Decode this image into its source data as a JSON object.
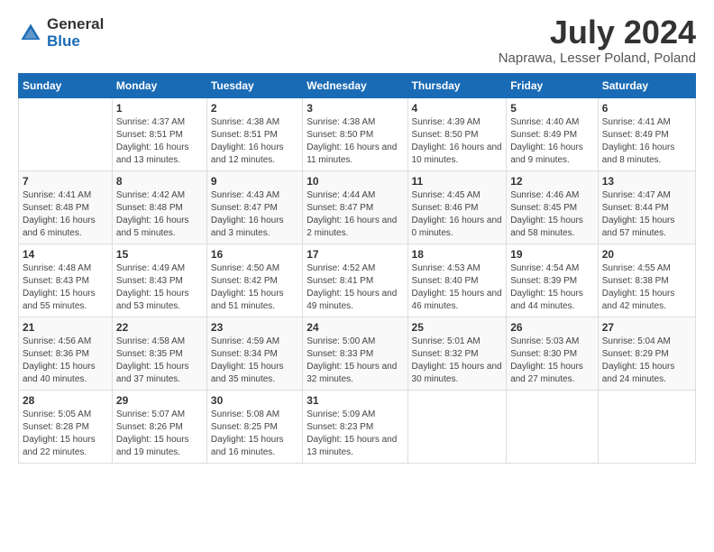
{
  "logo": {
    "general": "General",
    "blue": "Blue"
  },
  "title": "July 2024",
  "subtitle": "Naprawa, Lesser Poland, Poland",
  "columns": [
    "Sunday",
    "Monday",
    "Tuesday",
    "Wednesday",
    "Thursday",
    "Friday",
    "Saturday"
  ],
  "weeks": [
    [
      {
        "day": "",
        "sunrise": "",
        "sunset": "",
        "daylight": ""
      },
      {
        "day": "1",
        "sunrise": "Sunrise: 4:37 AM",
        "sunset": "Sunset: 8:51 PM",
        "daylight": "Daylight: 16 hours and 13 minutes."
      },
      {
        "day": "2",
        "sunrise": "Sunrise: 4:38 AM",
        "sunset": "Sunset: 8:51 PM",
        "daylight": "Daylight: 16 hours and 12 minutes."
      },
      {
        "day": "3",
        "sunrise": "Sunrise: 4:38 AM",
        "sunset": "Sunset: 8:50 PM",
        "daylight": "Daylight: 16 hours and 11 minutes."
      },
      {
        "day": "4",
        "sunrise": "Sunrise: 4:39 AM",
        "sunset": "Sunset: 8:50 PM",
        "daylight": "Daylight: 16 hours and 10 minutes."
      },
      {
        "day": "5",
        "sunrise": "Sunrise: 4:40 AM",
        "sunset": "Sunset: 8:49 PM",
        "daylight": "Daylight: 16 hours and 9 minutes."
      },
      {
        "day": "6",
        "sunrise": "Sunrise: 4:41 AM",
        "sunset": "Sunset: 8:49 PM",
        "daylight": "Daylight: 16 hours and 8 minutes."
      }
    ],
    [
      {
        "day": "7",
        "sunrise": "Sunrise: 4:41 AM",
        "sunset": "Sunset: 8:48 PM",
        "daylight": "Daylight: 16 hours and 6 minutes."
      },
      {
        "day": "8",
        "sunrise": "Sunrise: 4:42 AM",
        "sunset": "Sunset: 8:48 PM",
        "daylight": "Daylight: 16 hours and 5 minutes."
      },
      {
        "day": "9",
        "sunrise": "Sunrise: 4:43 AM",
        "sunset": "Sunset: 8:47 PM",
        "daylight": "Daylight: 16 hours and 3 minutes."
      },
      {
        "day": "10",
        "sunrise": "Sunrise: 4:44 AM",
        "sunset": "Sunset: 8:47 PM",
        "daylight": "Daylight: 16 hours and 2 minutes."
      },
      {
        "day": "11",
        "sunrise": "Sunrise: 4:45 AM",
        "sunset": "Sunset: 8:46 PM",
        "daylight": "Daylight: 16 hours and 0 minutes."
      },
      {
        "day": "12",
        "sunrise": "Sunrise: 4:46 AM",
        "sunset": "Sunset: 8:45 PM",
        "daylight": "Daylight: 15 hours and 58 minutes."
      },
      {
        "day": "13",
        "sunrise": "Sunrise: 4:47 AM",
        "sunset": "Sunset: 8:44 PM",
        "daylight": "Daylight: 15 hours and 57 minutes."
      }
    ],
    [
      {
        "day": "14",
        "sunrise": "Sunrise: 4:48 AM",
        "sunset": "Sunset: 8:43 PM",
        "daylight": "Daylight: 15 hours and 55 minutes."
      },
      {
        "day": "15",
        "sunrise": "Sunrise: 4:49 AM",
        "sunset": "Sunset: 8:43 PM",
        "daylight": "Daylight: 15 hours and 53 minutes."
      },
      {
        "day": "16",
        "sunrise": "Sunrise: 4:50 AM",
        "sunset": "Sunset: 8:42 PM",
        "daylight": "Daylight: 15 hours and 51 minutes."
      },
      {
        "day": "17",
        "sunrise": "Sunrise: 4:52 AM",
        "sunset": "Sunset: 8:41 PM",
        "daylight": "Daylight: 15 hours and 49 minutes."
      },
      {
        "day": "18",
        "sunrise": "Sunrise: 4:53 AM",
        "sunset": "Sunset: 8:40 PM",
        "daylight": "Daylight: 15 hours and 46 minutes."
      },
      {
        "day": "19",
        "sunrise": "Sunrise: 4:54 AM",
        "sunset": "Sunset: 8:39 PM",
        "daylight": "Daylight: 15 hours and 44 minutes."
      },
      {
        "day": "20",
        "sunrise": "Sunrise: 4:55 AM",
        "sunset": "Sunset: 8:38 PM",
        "daylight": "Daylight: 15 hours and 42 minutes."
      }
    ],
    [
      {
        "day": "21",
        "sunrise": "Sunrise: 4:56 AM",
        "sunset": "Sunset: 8:36 PM",
        "daylight": "Daylight: 15 hours and 40 minutes."
      },
      {
        "day": "22",
        "sunrise": "Sunrise: 4:58 AM",
        "sunset": "Sunset: 8:35 PM",
        "daylight": "Daylight: 15 hours and 37 minutes."
      },
      {
        "day": "23",
        "sunrise": "Sunrise: 4:59 AM",
        "sunset": "Sunset: 8:34 PM",
        "daylight": "Daylight: 15 hours and 35 minutes."
      },
      {
        "day": "24",
        "sunrise": "Sunrise: 5:00 AM",
        "sunset": "Sunset: 8:33 PM",
        "daylight": "Daylight: 15 hours and 32 minutes."
      },
      {
        "day": "25",
        "sunrise": "Sunrise: 5:01 AM",
        "sunset": "Sunset: 8:32 PM",
        "daylight": "Daylight: 15 hours and 30 minutes."
      },
      {
        "day": "26",
        "sunrise": "Sunrise: 5:03 AM",
        "sunset": "Sunset: 8:30 PM",
        "daylight": "Daylight: 15 hours and 27 minutes."
      },
      {
        "day": "27",
        "sunrise": "Sunrise: 5:04 AM",
        "sunset": "Sunset: 8:29 PM",
        "daylight": "Daylight: 15 hours and 24 minutes."
      }
    ],
    [
      {
        "day": "28",
        "sunrise": "Sunrise: 5:05 AM",
        "sunset": "Sunset: 8:28 PM",
        "daylight": "Daylight: 15 hours and 22 minutes."
      },
      {
        "day": "29",
        "sunrise": "Sunrise: 5:07 AM",
        "sunset": "Sunset: 8:26 PM",
        "daylight": "Daylight: 15 hours and 19 minutes."
      },
      {
        "day": "30",
        "sunrise": "Sunrise: 5:08 AM",
        "sunset": "Sunset: 8:25 PM",
        "daylight": "Daylight: 15 hours and 16 minutes."
      },
      {
        "day": "31",
        "sunrise": "Sunrise: 5:09 AM",
        "sunset": "Sunset: 8:23 PM",
        "daylight": "Daylight: 15 hours and 13 minutes."
      },
      {
        "day": "",
        "sunrise": "",
        "sunset": "",
        "daylight": ""
      },
      {
        "day": "",
        "sunrise": "",
        "sunset": "",
        "daylight": ""
      },
      {
        "day": "",
        "sunrise": "",
        "sunset": "",
        "daylight": ""
      }
    ]
  ]
}
